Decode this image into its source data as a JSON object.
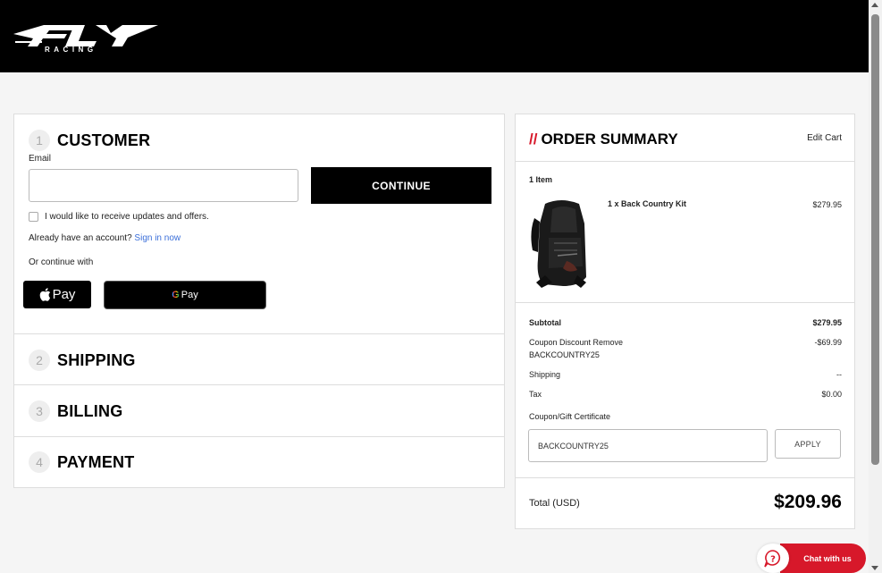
{
  "brand": {
    "logo_text": "FLY",
    "logo_subtext": "RACING"
  },
  "checkout": {
    "steps": [
      {
        "number": "1",
        "title": "CUSTOMER"
      },
      {
        "number": "2",
        "title": "SHIPPING"
      },
      {
        "number": "3",
        "title": "BILLING"
      },
      {
        "number": "4",
        "title": "PAYMENT"
      }
    ],
    "customer": {
      "email_label": "Email",
      "email_value": "",
      "continue_label": "CONTINUE",
      "updates_label": "I would like to receive updates and offers.",
      "account_prompt": "Already have an account?",
      "signin_label": "Sign in now",
      "continue_with": "Or continue with",
      "apple_pay_label": "Pay",
      "google_pay_label": "Pay"
    }
  },
  "summary": {
    "title_prefix": "//",
    "title": "ORDER SUMMARY",
    "edit_cart": "Edit Cart",
    "items_count": "1 Item",
    "item": {
      "name": "1 x Back Country Kit",
      "price": "$279.95"
    },
    "subtotal_label": "Subtotal",
    "subtotal_value": "$279.95",
    "coupon_label": "Coupon Discount Remove",
    "coupon_code": "BACKCOUNTRY25",
    "coupon_value": "-$69.99",
    "shipping_label": "Shipping",
    "shipping_value": "--",
    "tax_label": "Tax",
    "tax_value": "$0.00",
    "gift_label": "Coupon/Gift Certificate",
    "gift_input_value": "BACKCOUNTRY25",
    "apply_label": "APPLY",
    "total_label": "Total (USD)",
    "total_value": "$209.96"
  },
  "chat": {
    "label": "Chat with us"
  },
  "colors": {
    "accent": "#d7182a",
    "link": "#3b6fd9",
    "header_bg": "#000000"
  },
  "icons": [
    "apple-icon",
    "google-g-icon",
    "chat-help-icon",
    "checkbox-icon",
    "backpack-image"
  ]
}
